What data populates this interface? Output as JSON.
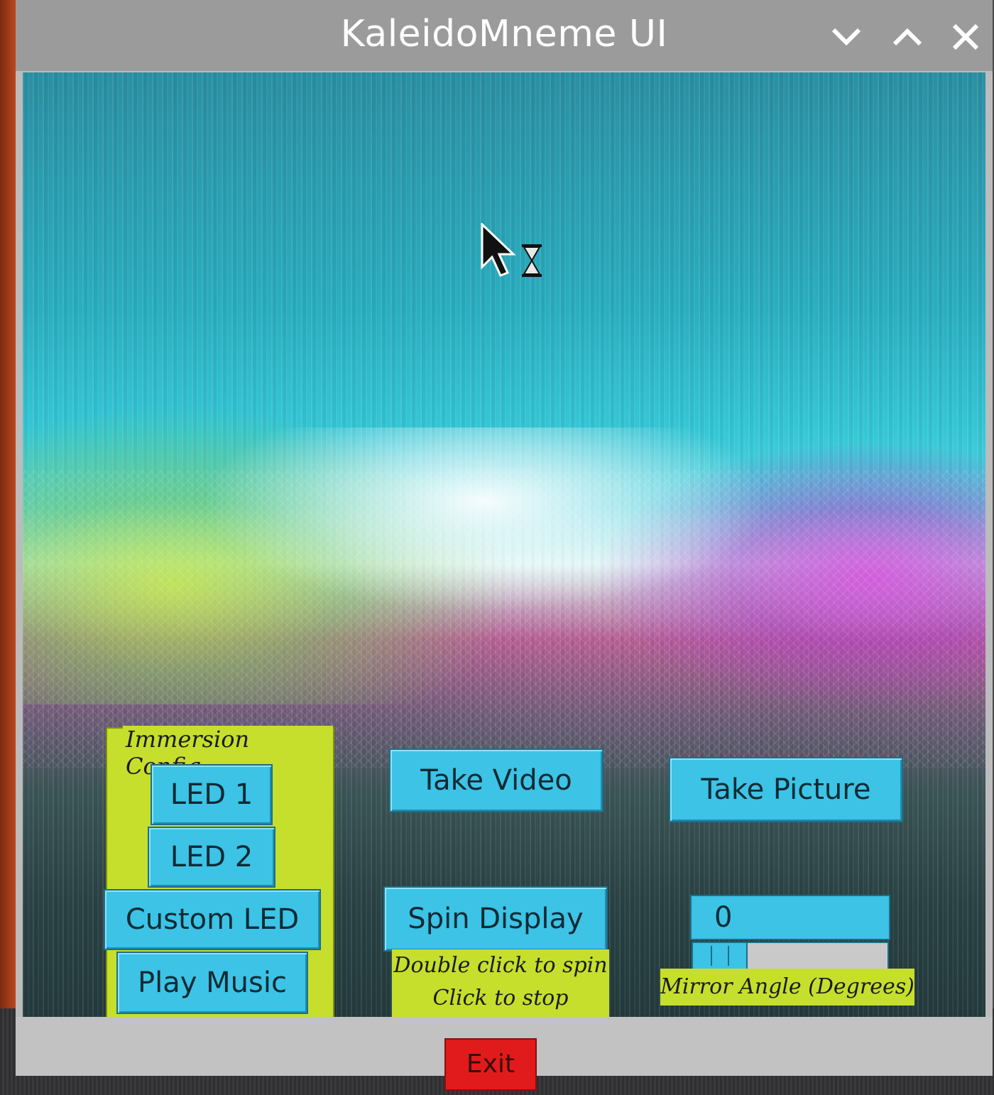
{
  "window": {
    "title": "KaleidoMneme UI"
  },
  "controls": {
    "minimize": "chevron-down-icon",
    "maximize": "chevron-up-icon",
    "close": "close-icon"
  },
  "immersion": {
    "title": "Immersion Config",
    "led1": "LED 1",
    "led2": "LED 2",
    "custom_led": "Custom LED",
    "play_music": "Play Music"
  },
  "camera": {
    "take_video": "Take Video",
    "take_picture": "Take Picture"
  },
  "spin": {
    "button": "Spin Display",
    "hint_line1": "Double click to spin",
    "hint_line2": "Click to stop"
  },
  "mirror": {
    "value": "0",
    "label": "Mirror Angle (Degrees)",
    "slider_fraction": 0.28
  },
  "footer": {
    "exit": "Exit"
  },
  "colors": {
    "button": "#3cc3e6",
    "panel": "#c6df2c",
    "exit": "#e11b1b",
    "titlebar": "#9b9b9b"
  }
}
